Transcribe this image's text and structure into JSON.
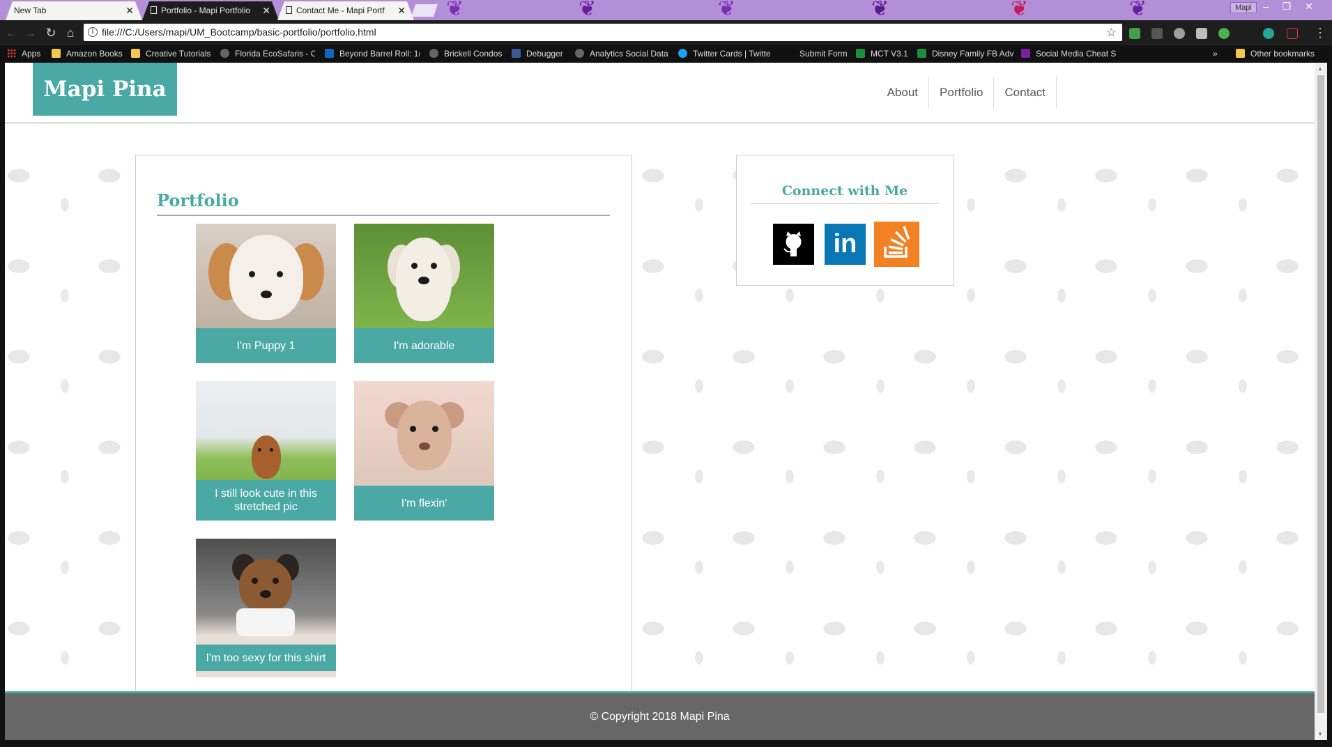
{
  "browser": {
    "tabs": [
      {
        "title": "New Tab",
        "active": false
      },
      {
        "title": "Portfolio - Mapi Portfolio",
        "active": true
      },
      {
        "title": "Contact Me - Mapi Portf",
        "active": false
      }
    ],
    "profile_name": "Mapi",
    "url": "file:///C:/Users/mapi/UM_Bootcamp/basic-portfolio/portfolio.html",
    "bookmarks": [
      {
        "label": "Apps",
        "icon": "apps-grid-icon"
      },
      {
        "label": "Amazon Books",
        "icon": "folder-icon"
      },
      {
        "label": "Creative Tutorials",
        "icon": "folder-icon"
      },
      {
        "label": "Florida EcoSafaris - C",
        "icon": "leaf-icon"
      },
      {
        "label": "Beyond Barrel Roll: 1(",
        "icon": "site-icon"
      },
      {
        "label": "Brickell Condos",
        "icon": "site-icon"
      },
      {
        "label": "Debugger",
        "icon": "facebook-icon"
      },
      {
        "label": "Analytics Social Data",
        "icon": "site-icon"
      },
      {
        "label": "Twitter Cards | Twitte",
        "icon": "twitter-icon"
      },
      {
        "label": "Submit Form",
        "icon": "blank-icon"
      },
      {
        "label": "MCT V3.1",
        "icon": "sheets-icon"
      },
      {
        "label": "Disney Family FB Adv",
        "icon": "sheets-icon"
      },
      {
        "label": "Social Media Cheat S",
        "icon": "site-icon"
      }
    ],
    "overflow_label": "»",
    "other_bookmarks": "Other bookmarks"
  },
  "site": {
    "brand": "Mapi Pina",
    "nav": [
      "About",
      "Portfolio",
      "Contact"
    ],
    "portfolio_title": "Portfolio",
    "gallery": [
      {
        "caption": "I'm Puppy 1"
      },
      {
        "caption": "I'm adorable"
      },
      {
        "caption": "I still look cute in this stretched pic"
      },
      {
        "caption": "I'm flexin'"
      },
      {
        "caption": "I'm too sexy for this shirt"
      }
    ],
    "connect_title": "Connect with Me",
    "social": [
      "github-icon",
      "linkedin-icon",
      "stackoverflow-icon"
    ],
    "linkedin_glyph": "in",
    "footer": "© Copyright 2018 Mapi Pina"
  },
  "colors": {
    "accent": "#4aa9a4",
    "footer": "#676767",
    "stackoverflow": "#f48024",
    "linkedin": "#0a77b5"
  }
}
